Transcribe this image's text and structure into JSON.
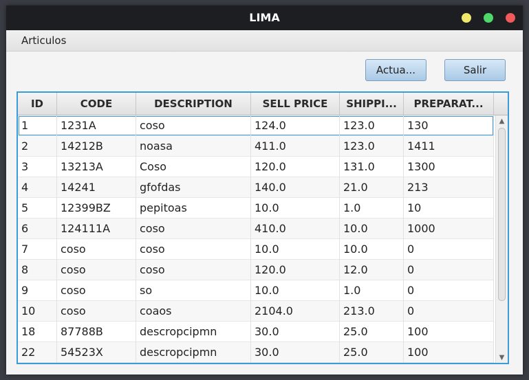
{
  "window": {
    "title": "LIMA"
  },
  "menubar": {
    "items": [
      "Articulos"
    ]
  },
  "toolbar": {
    "actua_label": "Actua...",
    "salir_label": "Salir"
  },
  "table": {
    "headers": [
      "ID",
      "CODE",
      "DESCRIPTION",
      "SELL PRICE",
      "SHIPPI...",
      "PREPARAT..."
    ],
    "rows": [
      [
        "1",
        "1231A",
        "coso",
        "124.0",
        "123.0",
        "130"
      ],
      [
        "2",
        "14212B",
        "noasa",
        "411.0",
        "123.0",
        "1411"
      ],
      [
        "3",
        "13213A",
        "Coso",
        "120.0",
        "131.0",
        "1300"
      ],
      [
        "4",
        "14241",
        "gfofdas",
        "140.0",
        "21.0",
        "213"
      ],
      [
        "5",
        "12399BZ",
        "pepitoas",
        "10.0",
        "1.0",
        "10"
      ],
      [
        "6",
        "124111A",
        "coso",
        "410.0",
        "10.0",
        "1000"
      ],
      [
        "7",
        "coso",
        "coso",
        "10.0",
        "10.0",
        "0"
      ],
      [
        "8",
        "coso",
        "coso",
        "120.0",
        "12.0",
        "0"
      ],
      [
        "9",
        "coso",
        "so",
        "10.0",
        "1.0",
        "0"
      ],
      [
        "10",
        "coso",
        "coaos",
        "2104.0",
        "213.0",
        "0"
      ],
      [
        "18",
        "87788B",
        "descropcipmn",
        "30.0",
        "25.0",
        "100"
      ],
      [
        "22",
        "54523X",
        "descropcipmn",
        "30.0",
        "25.0",
        "100"
      ]
    ],
    "selected_row": 0
  },
  "colors": {
    "accent": "#3a9bd8",
    "titlebar": "#1c1e22",
    "button": "#a9c9e6"
  }
}
